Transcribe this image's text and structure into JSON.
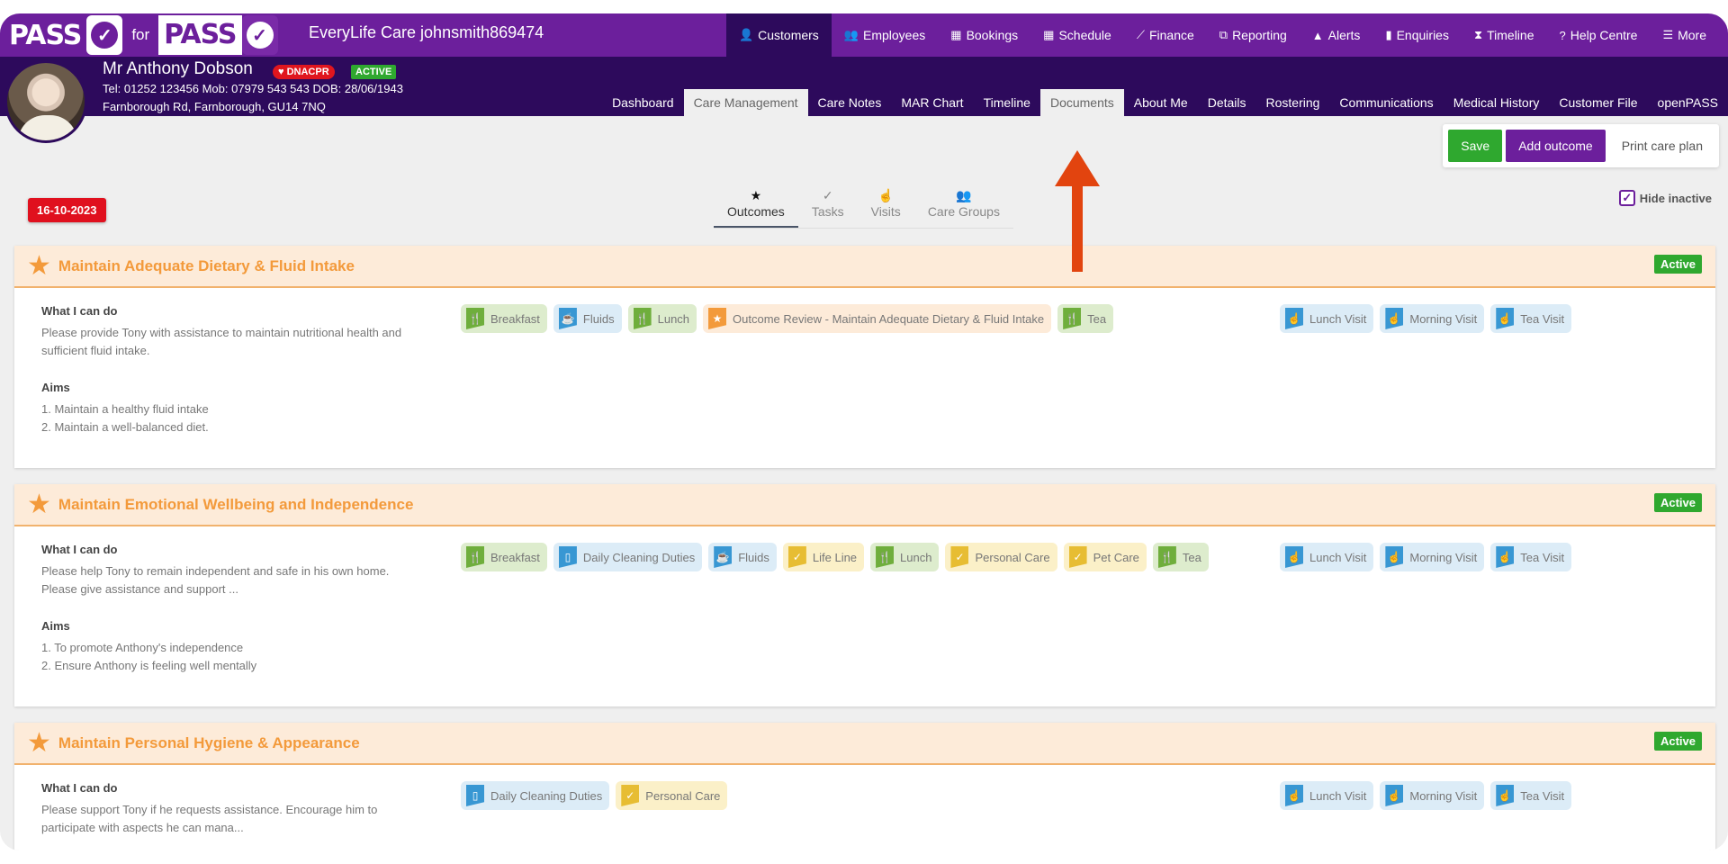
{
  "app": {
    "logo_left": "PASS",
    "logo_for": "for",
    "logo_right": "PASS",
    "title": "EveryLife Care johnsmith869474"
  },
  "top_nav": [
    {
      "label": "Customers",
      "icon": "user-icon",
      "glyph": "👤",
      "active": true
    },
    {
      "label": "Employees",
      "icon": "users-icon",
      "glyph": "👥"
    },
    {
      "label": "Bookings",
      "icon": "calendar-icon",
      "glyph": "▦"
    },
    {
      "label": "Schedule",
      "icon": "calendar-icon",
      "glyph": "▦"
    },
    {
      "label": "Finance",
      "icon": "line-chart-icon",
      "glyph": "⟋"
    },
    {
      "label": "Reporting",
      "icon": "copy-icon",
      "glyph": "⧉"
    },
    {
      "label": "Alerts",
      "icon": "warning-icon",
      "glyph": "▲"
    },
    {
      "label": "Enquiries",
      "icon": "file-icon",
      "glyph": "▮"
    },
    {
      "label": "Timeline",
      "icon": "hourglass-icon",
      "glyph": "⧗"
    },
    {
      "label": "Help Centre",
      "icon": "help-icon",
      "glyph": "?"
    },
    {
      "label": "More",
      "icon": "menu-icon",
      "glyph": "☰"
    }
  ],
  "patient": {
    "name": "Mr Anthony Dobson",
    "dnacpr": "DNACPR",
    "status": "ACTIVE",
    "contact": "Tel: 01252 123456  Mob: 07979 543 543  DOB: 28/06/1943",
    "address": "Farnborough Rd, Farnborough, GU14 7NQ"
  },
  "sub_nav": [
    {
      "label": "Dashboard"
    },
    {
      "label": "Care Management",
      "active": true
    },
    {
      "label": "Care Notes"
    },
    {
      "label": "MAR Chart"
    },
    {
      "label": "Timeline"
    },
    {
      "label": "Documents",
      "active": true
    },
    {
      "label": "About Me"
    },
    {
      "label": "Details"
    },
    {
      "label": "Rostering"
    },
    {
      "label": "Communications"
    },
    {
      "label": "Medical History"
    },
    {
      "label": "Customer File"
    },
    {
      "label": "openPASS"
    }
  ],
  "actions": {
    "save": "Save",
    "add_outcome": "Add outcome",
    "print": "Print care plan"
  },
  "date_badge": "16-10-2023",
  "sub_tabs": [
    {
      "label": "Outcomes",
      "icon": "star-icon",
      "glyph": "★",
      "active": true
    },
    {
      "label": "Tasks",
      "icon": "check-icon",
      "glyph": "✓"
    },
    {
      "label": "Visits",
      "icon": "hand-pointer-icon",
      "glyph": "☝"
    },
    {
      "label": "Care Groups",
      "icon": "users-icon",
      "glyph": "👥"
    }
  ],
  "hide_inactive": {
    "label": "Hide inactive",
    "checked": true
  },
  "labels": {
    "what_i_can_do": "What I can do",
    "aims": "Aims"
  },
  "outcomes": [
    {
      "title": "Maintain Adequate Dietary & Fluid Intake",
      "status": "Active",
      "what_i_can_do": "Please provide Tony with assistance to maintain nutritional health and sufficient fluid intake.",
      "aims": [
        "1. Maintain a healthy fluid intake",
        "2. Maintain a well-balanced diet."
      ],
      "tasks": [
        {
          "label": "Breakfast",
          "color": "green",
          "icon": "cutlery-icon"
        },
        {
          "label": "Fluids",
          "color": "blue",
          "icon": "cup-icon"
        },
        {
          "label": "Lunch",
          "color": "green",
          "icon": "cutlery-icon"
        },
        {
          "label": "Outcome Review - Maintain Adequate Dietary & Fluid Intake",
          "color": "orange",
          "icon": "star-icon"
        },
        {
          "label": "Tea",
          "color": "green",
          "icon": "cutlery-icon"
        }
      ],
      "visits": [
        "Lunch Visit",
        "Morning Visit",
        "Tea Visit"
      ]
    },
    {
      "title": "Maintain Emotional Wellbeing and Independence",
      "status": "Active",
      "what_i_can_do": "Please help Tony to remain independent and safe in his own home. Please give assistance and support ...",
      "aims": [
        "1. To promote Anthony's independence",
        "2. Ensure Anthony is feeling well mentally"
      ],
      "tasks": [
        {
          "label": "Breakfast",
          "color": "green",
          "icon": "cutlery-icon"
        },
        {
          "label": "Daily Cleaning Duties",
          "color": "blue",
          "icon": "file-icon"
        },
        {
          "label": "Fluids",
          "color": "blue",
          "icon": "cup-icon"
        },
        {
          "label": "Life Line",
          "color": "yellow",
          "icon": "check-icon"
        },
        {
          "label": "Lunch",
          "color": "green",
          "icon": "cutlery-icon"
        },
        {
          "label": "Personal Care",
          "color": "yellow",
          "icon": "check-icon"
        },
        {
          "label": "Pet Care",
          "color": "yellow",
          "icon": "check-icon"
        },
        {
          "label": "Tea",
          "color": "green",
          "icon": "cutlery-icon"
        }
      ],
      "visits": [
        "Lunch Visit",
        "Morning Visit",
        "Tea Visit"
      ]
    },
    {
      "title": "Maintain Personal Hygiene & Appearance",
      "status": "Active",
      "what_i_can_do": "Please support Tony if he requests assistance. Encourage him to participate with aspects he can mana...",
      "aims": [],
      "tasks": [
        {
          "label": "Daily Cleaning Duties",
          "color": "blue",
          "icon": "file-icon"
        },
        {
          "label": "Personal Care",
          "color": "yellow",
          "icon": "check-icon"
        }
      ],
      "visits": [
        "Lunch Visit",
        "Morning Visit",
        "Tea Visit"
      ]
    }
  ],
  "colors": {
    "brand_purple": "#6c1f9c",
    "dark_purple": "#2d0a5c",
    "active_green": "#2fa82f",
    "date_red": "#e0101e",
    "outcome_orange": "#f39a3b",
    "arrow": "#e2440f"
  }
}
